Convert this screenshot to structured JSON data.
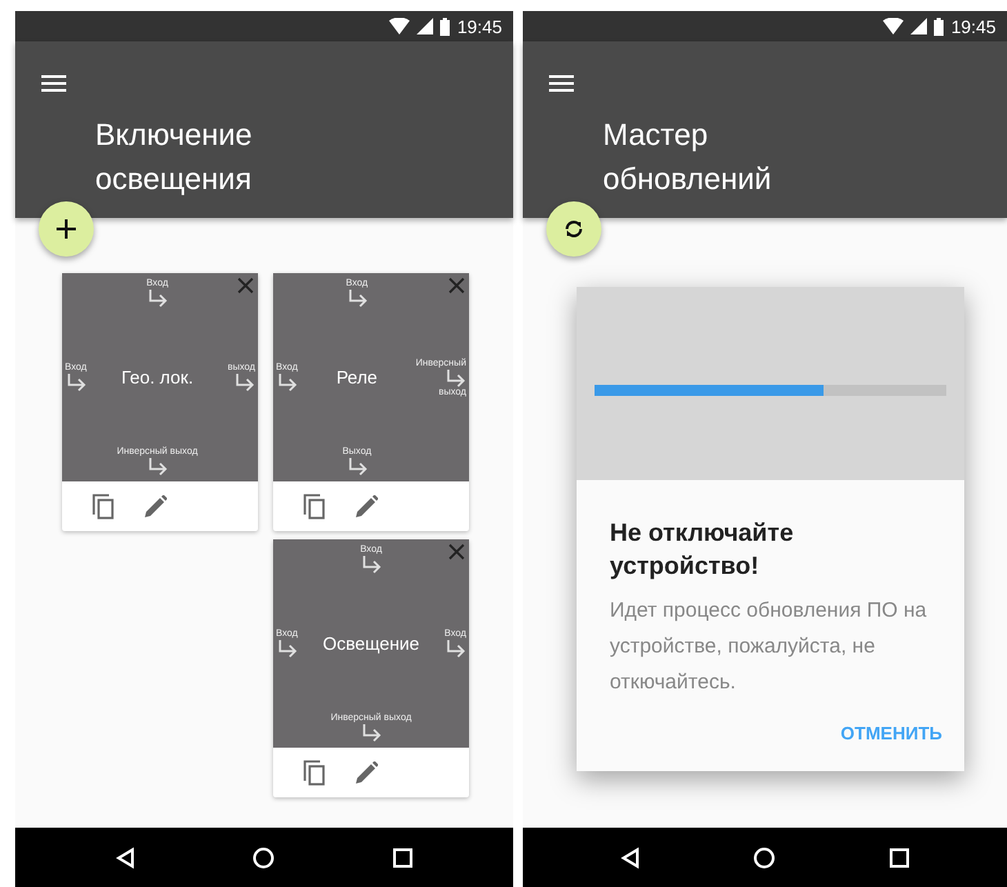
{
  "screens": [
    {
      "status_bar": {
        "time": "19:45"
      },
      "app_bar": {
        "title": "Включение освещения"
      },
      "fab": {
        "kind": "add"
      },
      "card_columns": [
        [
          {
            "title": "Гео. лок.",
            "ports": {
              "top": {
                "label": "Вход"
              },
              "left": {
                "label": "Вход"
              },
              "right": {
                "label": "выход"
              },
              "bottom": {
                "label": "Инверсный выход"
              }
            }
          }
        ],
        [
          {
            "title": "Реле",
            "ports": {
              "top": {
                "label": "Вход"
              },
              "left": {
                "label": "Вход"
              },
              "right": {
                "label": "Инверсный",
                "label_below": "выход"
              },
              "bottom": {
                "label": "Выход"
              }
            }
          },
          {
            "title": "Освещение",
            "ports": {
              "top": {
                "label": "Вход"
              },
              "left": {
                "label": "Вход"
              },
              "right": {
                "label": "Вход"
              },
              "bottom": {
                "label": "Инверсный выход"
              }
            }
          }
        ]
      ]
    },
    {
      "status_bar": {
        "time": "19:45"
      },
      "app_bar": {
        "title": "Мастер обновлений"
      },
      "fab": {
        "kind": "sync"
      },
      "dialog": {
        "progress": {
          "level": 0.65
        },
        "title": "Не отключайте устройство!",
        "body": "Идет процесс обновления ПО на устройстве, пожалуйста, не откючайтесь.",
        "action": "ОТМЕНИТЬ"
      }
    }
  ]
}
